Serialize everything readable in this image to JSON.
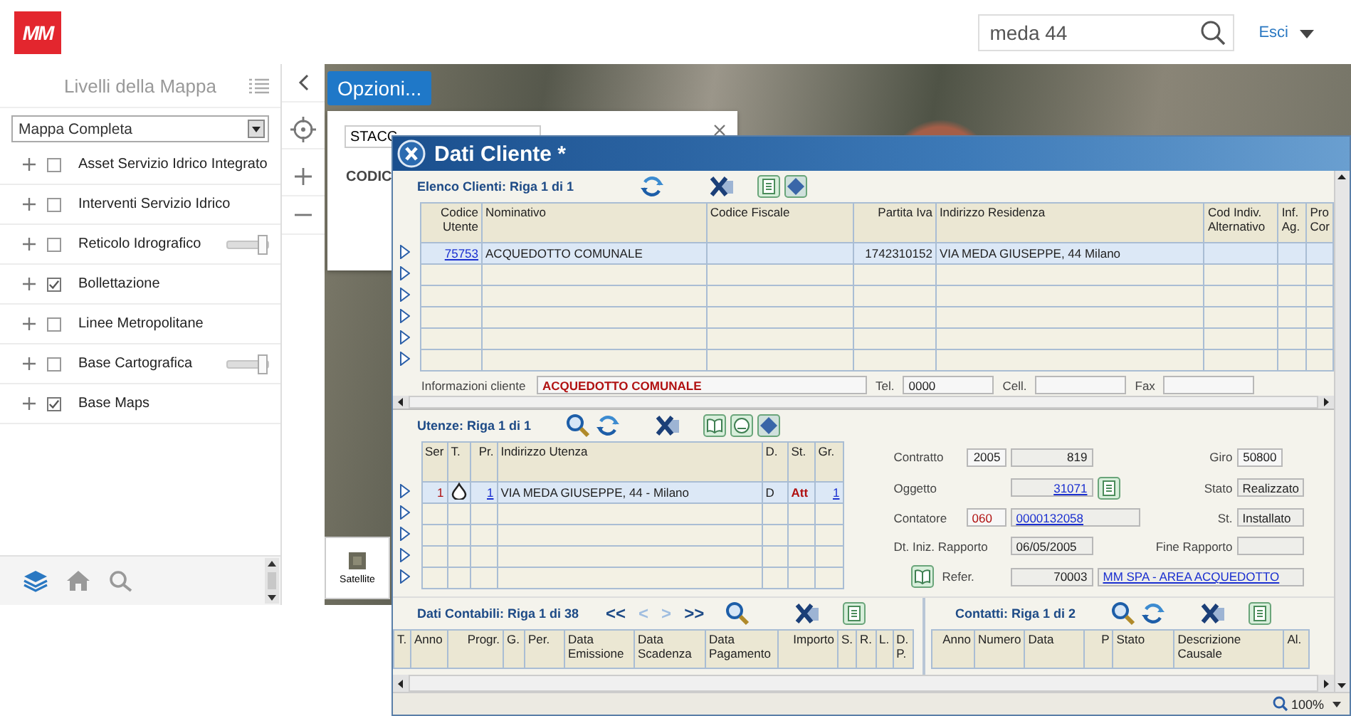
{
  "header": {
    "logo": "MM",
    "search": {
      "value": "meda 44"
    },
    "user_menu": "Esci"
  },
  "sidebar": {
    "title": "Livelli della Mappa",
    "preset": "Mappa Completa",
    "layers": [
      {
        "kind": "plain",
        "label": "Asset Servizio Idrico Integrato",
        "checked": false
      },
      {
        "kind": "plain",
        "label": "Interventi Servizio Idrico",
        "checked": false
      },
      {
        "kind": "slider",
        "label": "Reticolo Idrografico",
        "checked": false,
        "level": 1
      },
      {
        "kind": "plain",
        "label": "Bollettazione",
        "checked": true
      },
      {
        "kind": "plain",
        "label": "Linee Metropolitane",
        "checked": false
      },
      {
        "kind": "slider",
        "label": "Base Cartografica",
        "checked": false,
        "level": 1
      },
      {
        "kind": "plain",
        "label": "Base Maps",
        "checked": true
      }
    ],
    "bottom_tabs": [
      {
        "selected": true
      },
      {
        "selected": false
      },
      {
        "selected": false
      }
    ]
  },
  "map": {
    "options_button": "Opzioni...",
    "options_panel": {
      "field": "STACC",
      "heading": "CODIC"
    },
    "basemap_button": "Satellite"
  },
  "dialog": {
    "title": "Dati Cliente *",
    "clients": {
      "caption": "Elenco Clienti: Riga 1 di 1",
      "columns": [
        "Codice Utente",
        "Nominativo",
        "Codice Fiscale",
        "Partita Iva",
        "Indirizzo Residenza",
        "Cod Indiv. Alternativo",
        "Inf. Ag.",
        "Pro Cor"
      ],
      "rows": [
        {
          "selected": true,
          "cells": [
            {
              "kind": "link",
              "text": "75753"
            },
            {
              "kind": "plain",
              "text": "ACQUEDOTTO COMUNALE"
            },
            {
              "kind": "empty"
            },
            {
              "kind": "number",
              "text": "1742310152"
            },
            {
              "kind": "plain",
              "text": "VIA MEDA GIUSEPPE, 44 Milano"
            },
            {
              "kind": "empty"
            },
            {
              "kind": "empty"
            },
            {
              "kind": "empty"
            }
          ]
        }
      ],
      "info": {
        "label": "Informazioni cliente",
        "value": "ACQUEDOTTO COMUNALE",
        "tel_label": "Tel.",
        "tel": "0000",
        "cell_label": "Cell.",
        "fax_label": "Fax"
      }
    },
    "utenze": {
      "caption": "Utenze: Riga 1 di 1",
      "columns": [
        "Ser",
        "T.",
        "Pr.",
        "Indirizzo Utenza",
        "D.",
        "St.",
        "Gr."
      ],
      "rows": [
        {
          "selected": true,
          "cells": [
            {
              "kind": "alert-number",
              "text": "1"
            },
            {
              "kind": "icon"
            },
            {
              "kind": "link",
              "text": "1"
            },
            {
              "kind": "plain",
              "text": "VIA MEDA GIUSEPPE, 44  - Milano"
            },
            {
              "kind": "plain",
              "text": "D"
            },
            {
              "kind": "alert",
              "text": "Att"
            },
            {
              "kind": "link",
              "text": "1"
            }
          ]
        }
      ]
    },
    "details": {
      "contratto": {
        "label": "Contratto",
        "year": "2005",
        "number": "819"
      },
      "giro": {
        "label": "Giro",
        "value": "50800"
      },
      "oggetto": {
        "label": "Oggetto",
        "value": "31071"
      },
      "stato": {
        "label": "Stato",
        "value": "Realizzato"
      },
      "contatore": {
        "label": "Contatore",
        "code": "060",
        "value": "0000132058"
      },
      "st": {
        "label": "St.",
        "value": "Installato"
      },
      "inizio": {
        "label": "Dt. Iniz. Rapporto",
        "value": "06/05/2005"
      },
      "fine": {
        "label": "Fine Rapporto"
      },
      "refer": {
        "label": "Refer.",
        "code": "70003",
        "value": "MM SPA - AREA ACQUEDOTTO"
      }
    },
    "contabili": {
      "caption": "Dati Contabili: Riga 1 di 38",
      "nav": [
        {
          "label": "<<",
          "disabled": false
        },
        {
          "label": "<",
          "disabled": true
        },
        {
          "label": ">",
          "disabled": true
        },
        {
          "label": ">>",
          "disabled": false
        }
      ],
      "columns": [
        "T.",
        "Anno",
        "Progr.",
        "G.",
        "Per.",
        "Data Emissione",
        "Data Scadenza",
        "Data Pagamento",
        "Importo",
        "S.",
        "R.",
        "L.",
        "D. P."
      ]
    },
    "contatti": {
      "caption": "Contatti: Riga 1 di 2",
      "columns": [
        "Anno",
        "Numero",
        "Data",
        "P",
        "Stato",
        "Descrizione Causale",
        "Al."
      ]
    },
    "zoom": "100%"
  }
}
